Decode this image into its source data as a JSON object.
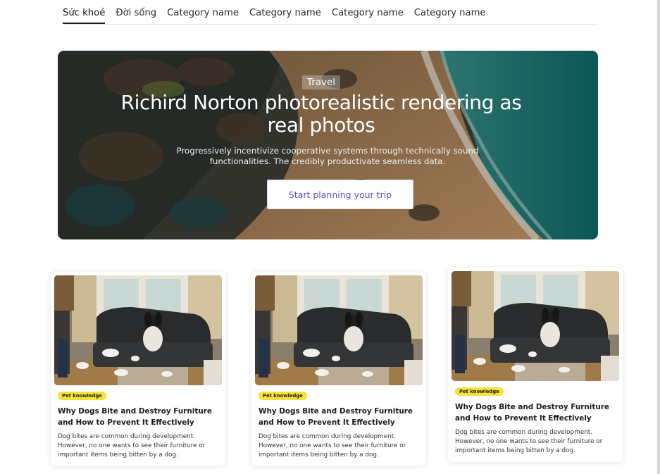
{
  "nav": {
    "tabs": [
      {
        "label": "Sức khoẻ"
      },
      {
        "label": "Đời sống"
      },
      {
        "label": "Category name"
      },
      {
        "label": "Category name"
      },
      {
        "label": "Category name"
      },
      {
        "label": "Category name"
      }
    ]
  },
  "hero": {
    "badge": "Travel",
    "title": "Richird Norton photorealistic rendering as real photos",
    "description": "Progressively incentivize cooperative systems through technically sound functionalities. The credibly productivate seamless data.",
    "button_label": "Start planning your trip",
    "image_icon": "coastline-aerial-photo"
  },
  "cards": [
    {
      "tag": "Pet knowledge",
      "title": "Why Dogs Bite and Destroy Furniture and How to Prevent It Effectively",
      "description": "Dog bites are common during development. However, no one wants to see their furniture or important items being bitten by a dog.",
      "image_icon": "dog-on-sofa-photo"
    },
    {
      "tag": "Pet knowledge",
      "title": "Why Dogs Bite and Destroy Furniture and How to Prevent It Effectively",
      "description": "Dog bites are common during development. However, no one wants to see their furniture or important items being bitten by a dog.",
      "image_icon": "dog-on-sofa-photo"
    },
    {
      "tag": "Pet knowledge",
      "title": "Why Dogs Bite and Destroy Furniture and How to Prevent It Effectively",
      "description": "Dog bites are common during development. However, no one wants to see their furniture or important items being bitten by a dog.",
      "image_icon": "dog-on-sofa-photo"
    }
  ],
  "colors": {
    "accent": "#5b4fc4",
    "tag_bg": "#f5e33a",
    "sea": "#1f8a86",
    "sand": "#b98a5c"
  }
}
